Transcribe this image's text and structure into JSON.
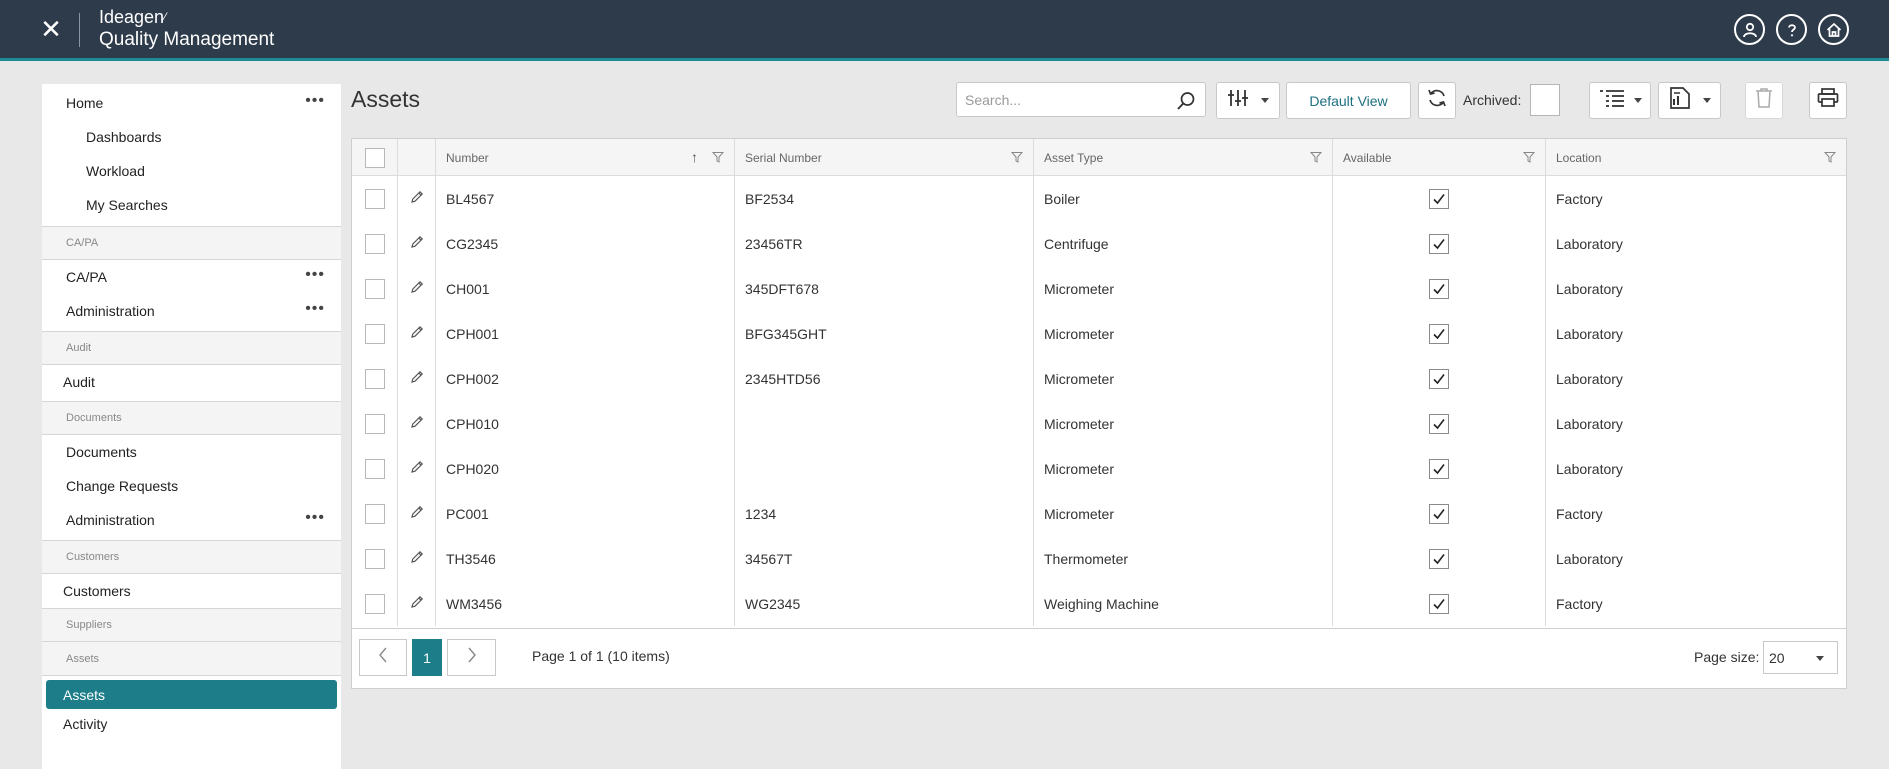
{
  "header": {
    "brand_top": "Ideagen",
    "brand_mark": "⁄",
    "product": "Quality Management",
    "close_icon": "close-icon",
    "icons": [
      "user-icon",
      "help-icon",
      "home-icon"
    ],
    "accent_color": "#1e8a94"
  },
  "sidebar": {
    "home": {
      "label": "Home",
      "dots": "•••"
    },
    "home_children": [
      "Dashboards",
      "Workload",
      "My Searches"
    ],
    "sec_capa": "CA/PA",
    "capa": {
      "label": "CA/PA",
      "dots": "•••"
    },
    "capa_admin": {
      "label": "Administration",
      "dots": "•••"
    },
    "sec_audit": "Audit",
    "audit": "Audit",
    "sec_documents": "Documents",
    "documents": "Documents",
    "change_requests": "Change Requests",
    "doc_admin": {
      "label": "Administration",
      "dots": "•••"
    },
    "sec_customers": "Customers",
    "customers": "Customers",
    "sec_suppliers": "Suppliers",
    "sec_assets": "Assets",
    "assets": "Assets",
    "activity": "Activity"
  },
  "main": {
    "title": "Assets",
    "search_placeholder": "Search...",
    "default_view": "Default View",
    "archived_label": "Archived:"
  },
  "grid": {
    "columns": [
      "Number",
      "Serial Number",
      "Asset Type",
      "Available",
      "Location"
    ],
    "rows": [
      {
        "number": "BL4567",
        "serial": "BF2534",
        "type": "Boiler",
        "available": true,
        "location": "Factory"
      },
      {
        "number": "CG2345",
        "serial": "23456TR",
        "type": "Centrifuge",
        "available": true,
        "location": "Laboratory"
      },
      {
        "number": "CH001",
        "serial": "345DFT678",
        "type": "Micrometer",
        "available": true,
        "location": "Laboratory"
      },
      {
        "number": "CPH001",
        "serial": "BFG345GHT",
        "type": "Micrometer",
        "available": true,
        "location": "Laboratory"
      },
      {
        "number": "CPH002",
        "serial": "2345HTD56",
        "type": "Micrometer",
        "available": true,
        "location": "Laboratory"
      },
      {
        "number": "CPH010",
        "serial": "",
        "type": "Micrometer",
        "available": true,
        "location": "Laboratory"
      },
      {
        "number": "CPH020",
        "serial": "",
        "type": "Micrometer",
        "available": true,
        "location": "Laboratory"
      },
      {
        "number": "PC001",
        "serial": "1234",
        "type": "Micrometer",
        "available": true,
        "location": "Factory"
      },
      {
        "number": "TH3546",
        "serial": "34567T",
        "type": "Thermometer",
        "available": true,
        "location": "Laboratory"
      },
      {
        "number": "WM3456",
        "serial": "WG2345",
        "type": "Weighing Machine",
        "available": true,
        "location": "Factory"
      }
    ]
  },
  "pager": {
    "current_page": "1",
    "info": "Page 1 of 1 (10 items)",
    "page_size_label": "Page size:",
    "page_size": "20"
  }
}
